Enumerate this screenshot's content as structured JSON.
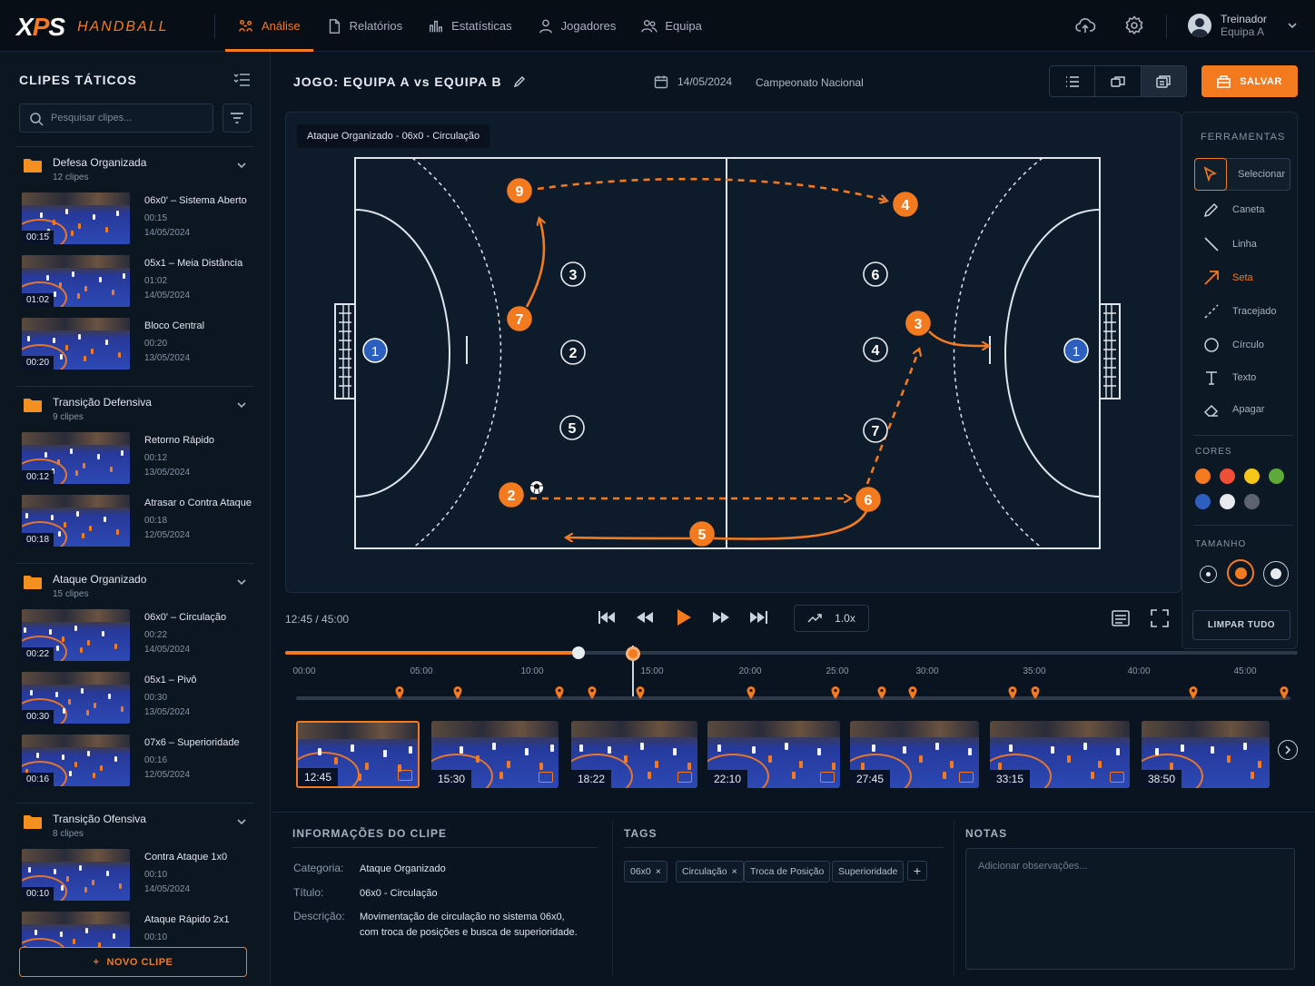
{
  "brand": {
    "logo": "XPS",
    "sub": "HANDBALL"
  },
  "nav": [
    {
      "label": "Análise",
      "icon": "analysis-icon"
    },
    {
      "label": "Relatórios",
      "icon": "report-icon"
    },
    {
      "label": "Estatísticas",
      "icon": "stats-icon"
    },
    {
      "label": "Jogadores",
      "icon": "user-icon"
    },
    {
      "label": "Equipa",
      "icon": "team-icon"
    }
  ],
  "user": {
    "name": "Treinador",
    "team": "Equipa A"
  },
  "sidebar": {
    "title": "CLIPES TÁTICOS",
    "search_placeholder": "Pesquisar clipes...",
    "folders": [
      {
        "name": "Defesa Organizada",
        "count": "12 clipes",
        "clips": [
          {
            "title": "06x0' – Sistema Aberto",
            "duration": "00:15",
            "date": "14/05/2024"
          },
          {
            "title": "05x1 – Meia Distância",
            "duration": "01:02",
            "date": "14/05/2024"
          },
          {
            "title": "Bloco Central",
            "duration": "00:20",
            "date": "13/05/2024"
          }
        ]
      },
      {
        "name": "Transição Defensiva",
        "count": "9 clipes",
        "clips": [
          {
            "title": "Retorno Rápido",
            "duration": "00:12",
            "date": "13/05/2024"
          },
          {
            "title": "Atrasar o Contra Ataque",
            "duration": "00:18",
            "date": "12/05/2024"
          }
        ]
      },
      {
        "name": "Ataque Organizado",
        "count": "15 clipes",
        "clips": [
          {
            "title": "06x0' – Circulação",
            "duration": "00:22",
            "date": "14/05/2024"
          },
          {
            "title": "05x1 – Pivô",
            "duration": "00:30",
            "date": "13/05/2024"
          },
          {
            "title": "07x6 – Superioridade",
            "duration": "00:16",
            "date": "12/05/2024"
          }
        ]
      },
      {
        "name": "Transição Ofensiva",
        "count": "8 clipes",
        "clips": [
          {
            "title": "Contra Ataque 1x0",
            "duration": "00:10",
            "date": "14/05/2024"
          },
          {
            "title": "Ataque Rápido 2x1",
            "duration": "00:10",
            "date": ""
          }
        ]
      }
    ],
    "new_clip": "NOVO CLIPE"
  },
  "game": {
    "title": "JOGO: EQUIPA A vs EQUIPA B",
    "date": "14/05/2024",
    "competition": "Campeonato Nacional",
    "save": "SALVAR"
  },
  "board": {
    "label": "Ataque Organizado - 06x0 - Circulação",
    "goalkeepers": [
      {
        "n": "1"
      },
      {
        "n": "1"
      }
    ],
    "white": [
      "3",
      "2",
      "5",
      "6",
      "4",
      "7"
    ],
    "orange": [
      "9",
      "7",
      "2",
      "4",
      "3",
      "6",
      "5"
    ]
  },
  "tools": {
    "title": "FERRAMENTAS",
    "items": [
      "Selecionar",
      "Caneta",
      "Linha",
      "Seta",
      "Tracejado",
      "Círculo",
      "Texto",
      "Apagar"
    ],
    "colors_label": "CORES",
    "colors": [
      "#f47a1f",
      "#f04e37",
      "#f5c518",
      "#5fa83a",
      "#2e5fbf",
      "#e6e9ee",
      "#5d6470"
    ],
    "size_label": "TAMANHO",
    "clear": "LIMPAR TUDO"
  },
  "player": {
    "time": "12:45  /  45:00",
    "speed": "1.0x",
    "current": 0.284
  },
  "timeline": {
    "ticks": [
      "00:00",
      "05:00",
      "10:00",
      "15:00",
      "20:00",
      "25:00",
      "30:00",
      "35:00",
      "40:00",
      "45:00"
    ],
    "thumbs": [
      "12:45",
      "15:30",
      "18:22",
      "22:10",
      "27:45",
      "33:15",
      "38:50"
    ]
  },
  "info": {
    "title": "INFORMAÇÕES DO CLIPE",
    "cat_label": "Categoria:",
    "cat": "Ataque Organizado",
    "tit_label": "Título:",
    "tit": "06x0 - Circulação",
    "desc_label": "Descrição:",
    "desc1": "Movimentação de circulação no sistema 06x0,",
    "desc2": "com troca de posições e busca de superioridade."
  },
  "tags": {
    "title": "TAGS",
    "items": [
      "06x0",
      "Circulação",
      "Troca de Posição",
      "Superioridade"
    ]
  },
  "notes": {
    "title": "NOTAS",
    "placeholder": "Adicionar observações..."
  }
}
